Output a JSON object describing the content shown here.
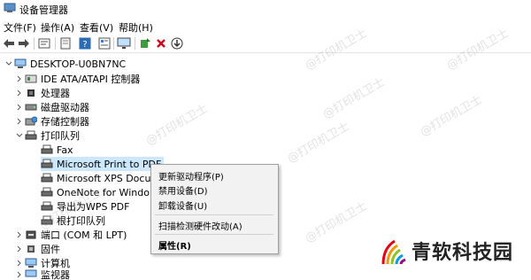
{
  "window": {
    "title": "设备管理器"
  },
  "menu": [
    "文件(F)",
    "操作(A)",
    "查看(V)",
    "帮助(H)"
  ],
  "toolbar_icons": [
    "back-arrow-icon",
    "forward-arrow-icon",
    "properties-icon",
    "help-book-icon",
    "help-question-icon",
    "details-icon",
    "monitor-icon",
    "update-driver-icon",
    "uninstall-x-icon",
    "download-icon"
  ],
  "tree": {
    "root": "DESKTOP-U0BN7NC",
    "items": [
      {
        "label": "IDE ATA/ATAPI 控制器"
      },
      {
        "label": "处理器"
      },
      {
        "label": "磁盘驱动器"
      },
      {
        "label": "存储控制器"
      },
      {
        "label": "打印队列"
      },
      {
        "label": "Fax"
      },
      {
        "label": "Microsoft Print to PDF"
      },
      {
        "label": "Microsoft XPS Docu"
      },
      {
        "label": "OneNote for Windo"
      },
      {
        "label": "导出为WPS PDF"
      },
      {
        "label": "根打印队列"
      },
      {
        "label": "端口 (COM 和 LPT)"
      },
      {
        "label": "固件"
      },
      {
        "label": "计算机"
      },
      {
        "label": "监视器"
      }
    ]
  },
  "context_menu": {
    "items": [
      "更新驱动程序(P)",
      "禁用设备(D)",
      "卸载设备(U)",
      "扫描检测硬件改动(A)",
      "属性(R)"
    ]
  },
  "watermark": "@打印机卫士",
  "brand": {
    "text": "青软科技园"
  },
  "colors": {
    "selection": "#cce8ff",
    "uninstall": "#d0021b",
    "menu_bg": "#f2f2f2"
  }
}
